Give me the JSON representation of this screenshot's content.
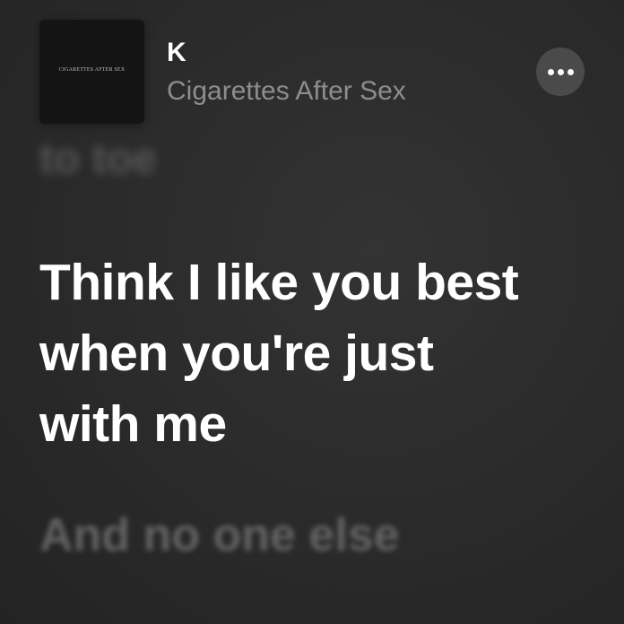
{
  "now_playing": {
    "album_art_text": "CIGARETTES AFTER SEX",
    "title": "K",
    "artist": "Cigarettes After Sex",
    "more_icon": "ellipsis-icon"
  },
  "lyrics": {
    "previous": "to toe",
    "current_lines": [
      "Think I like you best",
      "when you're just",
      "with me"
    ],
    "next": "And no one else"
  }
}
